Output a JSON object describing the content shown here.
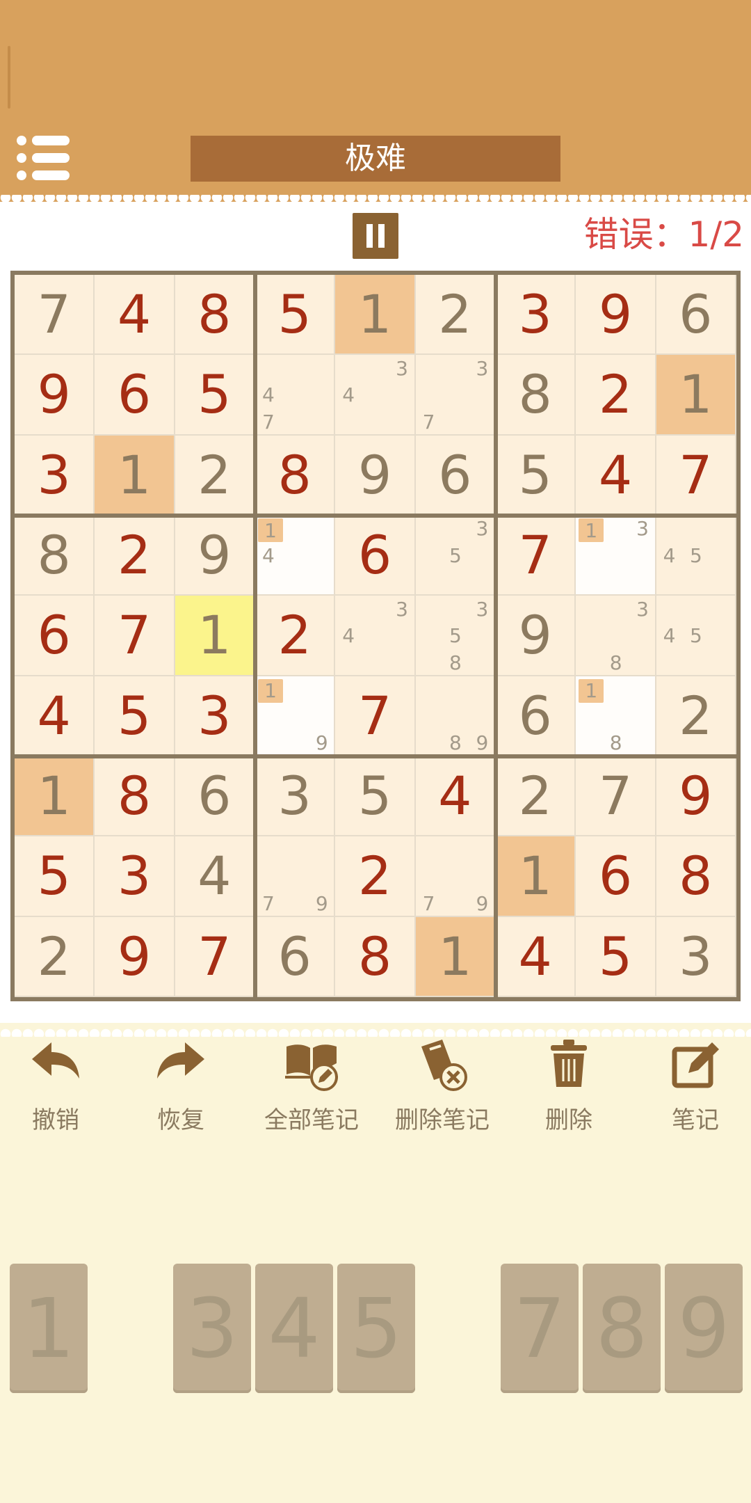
{
  "header": {
    "title": "极难"
  },
  "status": {
    "errors_label": "错误：1/2"
  },
  "colors": {
    "header": "#d8a15d",
    "title_bar": "#a86c38",
    "cell_bg": "#fdf0dc",
    "cell_highlight": "#f2c592",
    "cell_selected": "#fbf48c",
    "cell_empty": "#fffdfa",
    "entered_digit": "#a52d14",
    "given_digit": "#8c7a5f",
    "error_text": "#d94a46"
  },
  "board": {
    "rows": [
      [
        "7",
        "4",
        "8",
        "5",
        "1",
        "2",
        "3",
        "9",
        "6"
      ],
      [
        "9",
        "6",
        "5",
        "",
        "",
        "",
        "8",
        "2",
        "1"
      ],
      [
        "3",
        "1",
        "2",
        "8",
        "9",
        "6",
        "5",
        "4",
        "7"
      ],
      [
        "8",
        "2",
        "9",
        "",
        "6",
        "",
        "7",
        "",
        ""
      ],
      [
        "6",
        "7",
        "1",
        "2",
        "",
        "",
        "9",
        "",
        ""
      ],
      [
        "4",
        "5",
        "3",
        "",
        "7",
        "",
        "6",
        "",
        "2"
      ],
      [
        "1",
        "8",
        "6",
        "3",
        "5",
        "4",
        "2",
        "7",
        "9"
      ],
      [
        "5",
        "3",
        "4",
        "",
        "2",
        "",
        "1",
        "6",
        "8"
      ],
      [
        "2",
        "9",
        "7",
        "6",
        "8",
        "1",
        "4",
        "5",
        "3"
      ]
    ],
    "kinds": [
      [
        "g",
        "e",
        "e",
        "e",
        "g",
        "g",
        "e",
        "e",
        "g"
      ],
      [
        "e",
        "e",
        "e",
        "",
        "",
        "",
        "g",
        "e",
        "g"
      ],
      [
        "e",
        "g",
        "g",
        "e",
        "g",
        "g",
        "g",
        "e",
        "e"
      ],
      [
        "g",
        "e",
        "g",
        "",
        "e",
        "",
        "e",
        "",
        ""
      ],
      [
        "e",
        "e",
        "g",
        "e",
        "",
        "",
        "g",
        "",
        ""
      ],
      [
        "e",
        "e",
        "e",
        "",
        "e",
        "",
        "g",
        "",
        "g"
      ],
      [
        "g",
        "e",
        "g",
        "g",
        "g",
        "e",
        "g",
        "g",
        "e"
      ],
      [
        "e",
        "e",
        "g",
        "",
        "e",
        "",
        "g",
        "e",
        "e"
      ],
      [
        "g",
        "e",
        "e",
        "g",
        "e",
        "g",
        "e",
        "e",
        "g"
      ]
    ],
    "highlighted_cells": [
      [
        0,
        4
      ],
      [
        1,
        8
      ],
      [
        2,
        1
      ],
      [
        6,
        0
      ],
      [
        7,
        6
      ],
      [
        8,
        5
      ]
    ],
    "selected_cell": [
      4,
      2
    ],
    "empty_white_cells": [
      [
        3,
        3
      ],
      [
        3,
        7
      ],
      [
        5,
        3
      ],
      [
        5,
        7
      ]
    ],
    "notes": [
      {
        "cell": [
          1,
          3
        ],
        "marks": [
          {
            "d": "4",
            "pos": 3
          },
          {
            "d": "7",
            "pos": 6
          }
        ]
      },
      {
        "cell": [
          1,
          4
        ],
        "marks": [
          {
            "d": "3",
            "pos": 2
          },
          {
            "d": "4",
            "pos": 3
          }
        ]
      },
      {
        "cell": [
          1,
          5
        ],
        "marks": [
          {
            "d": "3",
            "pos": 2
          },
          {
            "d": "7",
            "pos": 6
          }
        ]
      },
      {
        "cell": [
          3,
          3
        ],
        "marks": [
          {
            "d": "1",
            "pos": 0,
            "hl": true
          },
          {
            "d": "4",
            "pos": 3
          }
        ]
      },
      {
        "cell": [
          3,
          5
        ],
        "marks": [
          {
            "d": "3",
            "pos": 2
          },
          {
            "d": "5",
            "pos": 4
          }
        ]
      },
      {
        "cell": [
          3,
          7
        ],
        "marks": [
          {
            "d": "1",
            "pos": 0,
            "hl": true
          },
          {
            "d": "3",
            "pos": 2
          }
        ]
      },
      {
        "cell": [
          3,
          8
        ],
        "marks": [
          {
            "d": "4",
            "pos": 3
          },
          {
            "d": "5",
            "pos": 4
          }
        ]
      },
      {
        "cell": [
          4,
          4
        ],
        "marks": [
          {
            "d": "3",
            "pos": 2
          },
          {
            "d": "4",
            "pos": 3
          }
        ]
      },
      {
        "cell": [
          4,
          5
        ],
        "marks": [
          {
            "d": "3",
            "pos": 2
          },
          {
            "d": "5",
            "pos": 4
          },
          {
            "d": "8",
            "pos": 7
          }
        ]
      },
      {
        "cell": [
          4,
          7
        ],
        "marks": [
          {
            "d": "3",
            "pos": 2
          },
          {
            "d": "8",
            "pos": 7
          }
        ]
      },
      {
        "cell": [
          4,
          8
        ],
        "marks": [
          {
            "d": "4",
            "pos": 3
          },
          {
            "d": "5",
            "pos": 4
          }
        ]
      },
      {
        "cell": [
          5,
          3
        ],
        "marks": [
          {
            "d": "1",
            "pos": 0,
            "hl": true
          },
          {
            "d": "9",
            "pos": 8
          }
        ]
      },
      {
        "cell": [
          5,
          5
        ],
        "marks": [
          {
            "d": "8",
            "pos": 7
          },
          {
            "d": "9",
            "pos": 8
          }
        ]
      },
      {
        "cell": [
          5,
          7
        ],
        "marks": [
          {
            "d": "1",
            "pos": 0,
            "hl": true
          },
          {
            "d": "8",
            "pos": 7
          }
        ]
      },
      {
        "cell": [
          7,
          3
        ],
        "marks": [
          {
            "d": "7",
            "pos": 6
          },
          {
            "d": "9",
            "pos": 8
          }
        ]
      },
      {
        "cell": [
          7,
          5
        ],
        "marks": [
          {
            "d": "7",
            "pos": 6
          },
          {
            "d": "9",
            "pos": 8
          }
        ]
      }
    ]
  },
  "toolbar": {
    "undo": "撤销",
    "redo": "恢复",
    "all_notes": "全部笔记",
    "delete_notes": "删除笔记",
    "delete": "删除",
    "notes": "笔记"
  },
  "keypad": {
    "keys": [
      "1",
      "",
      "3",
      "4",
      "5",
      "",
      "7",
      "8",
      "9"
    ]
  }
}
